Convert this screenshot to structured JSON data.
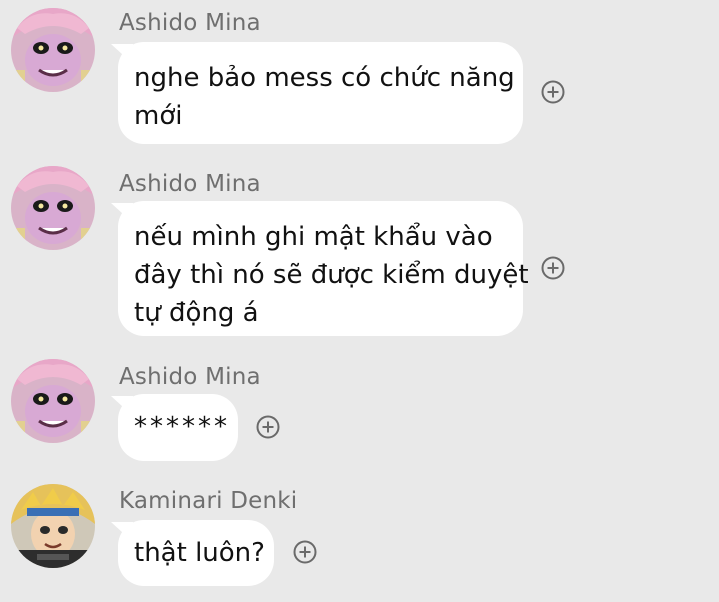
{
  "messages": [
    {
      "sender": "Ashido Mina",
      "lines": [
        "nghe bảo mess có chức năng",
        "mới"
      ],
      "avatar": "pink-hair-character-avatar"
    },
    {
      "sender": "Ashido Mina",
      "lines": [
        "nếu mình ghi mật khẩu vào",
        "đây thì nó sẽ được kiểm duyệt",
        "tự động á"
      ],
      "avatar": "pink-hair-character-avatar"
    },
    {
      "sender": "Ashido Mina",
      "lines": [
        "******"
      ],
      "avatar": "pink-hair-character-avatar"
    },
    {
      "sender": "Kaminari Denki",
      "lines": [
        "thật luôn?"
      ],
      "avatar": "blonde-hair-character-avatar"
    }
  ],
  "icons": {
    "reaction": "add-reaction-icon"
  },
  "colors": {
    "background": "#e9e9e9",
    "bubble": "#ffffff",
    "sender_text": "#6f6f6f",
    "message_text": "#111111",
    "icon": "#6a6a6a"
  }
}
